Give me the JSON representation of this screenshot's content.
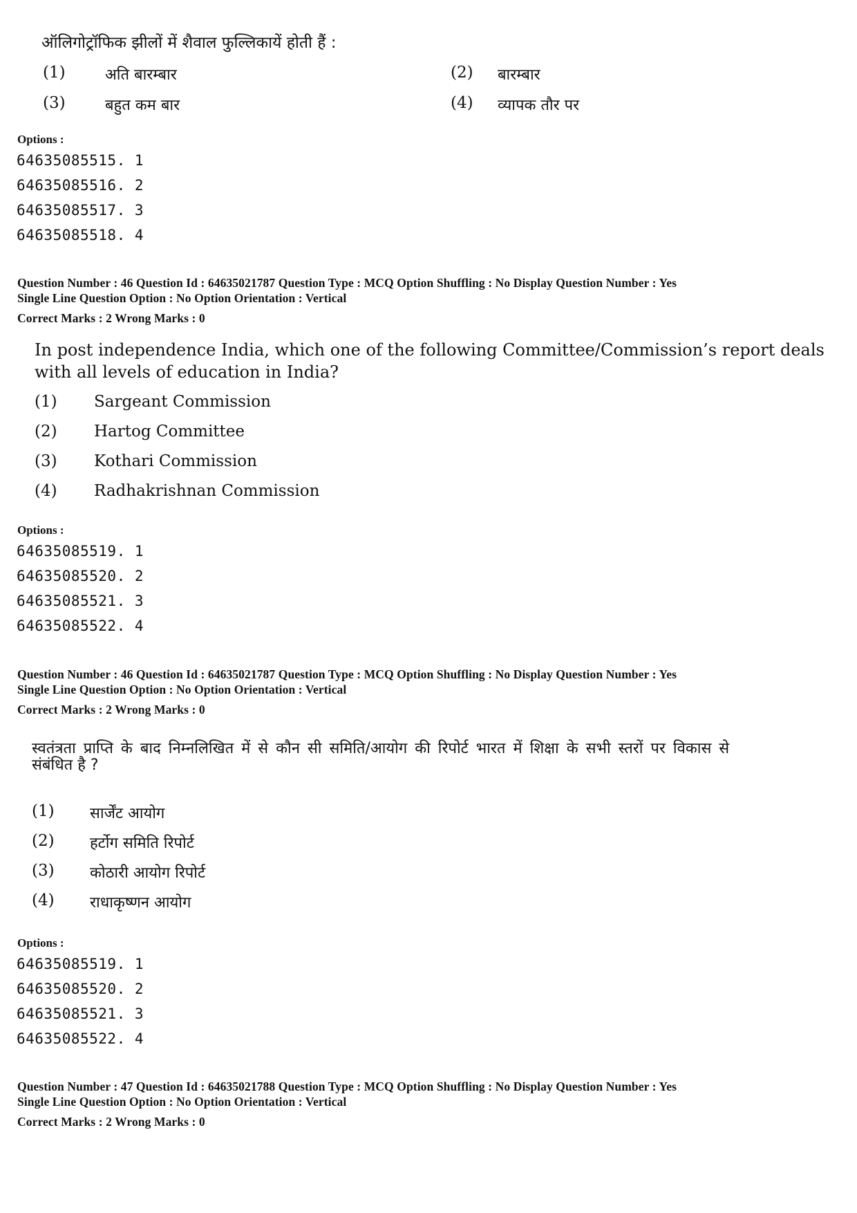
{
  "block1": {
    "question_text": "ऑलिगोट्रॉफिक झीलों में शैवाल फुल्लिकायें होती हैं :",
    "choices": [
      {
        "num": "(1)",
        "text": "अति बारम्बार"
      },
      {
        "num": "(2)",
        "text": "बारम्बार"
      },
      {
        "num": "(3)",
        "text": "बहुत कम बार"
      },
      {
        "num": "(4)",
        "text": "व्यापक तौर पर"
      }
    ],
    "options_label": "Options :",
    "option_ids": [
      "64635085515. 1",
      "64635085516. 2",
      "64635085517. 3",
      "64635085518. 4"
    ]
  },
  "block2": {
    "meta_line1": "Question Number : 46  Question Id : 64635021787  Question Type : MCQ  Option Shuffling : No  Display Question Number : Yes",
    "meta_line2": "Single Line Question Option : No  Option Orientation : Vertical",
    "marks": "Correct Marks : 2  Wrong Marks : 0",
    "question_line1": "In post independence India, which one of the following Committee/Commission’s report deals",
    "question_line2": "with all levels of education in India?",
    "choices": [
      {
        "num": "(1)",
        "text": "Sargeant Commission"
      },
      {
        "num": "(2)",
        "text": "Hartog Committee"
      },
      {
        "num": "(3)",
        "text": "Kothari Commission"
      },
      {
        "num": "(4)",
        "text": "Radhakrishnan Commission"
      }
    ],
    "options_label": "Options :",
    "option_ids": [
      "64635085519. 1",
      "64635085520. 2",
      "64635085521. 3",
      "64635085522. 4"
    ]
  },
  "block3": {
    "meta_line1": "Question Number : 46  Question Id : 64635021787  Question Type : MCQ  Option Shuffling : No  Display Question Number : Yes",
    "meta_line2": "Single Line Question Option : No  Option Orientation : Vertical",
    "marks": "Correct Marks : 2  Wrong Marks : 0",
    "question_line1": "स्वतंत्रता प्राप्ति के बाद निम्नलिखित में से कौन सी समिति/आयोग की रिपोर्ट भारत में शिक्षा के सभी स्तरों पर विकास से",
    "question_line2": "संबंधित है ?",
    "choices": [
      {
        "num": "(1)",
        "text": "सार्जेंट आयोग"
      },
      {
        "num": "(2)",
        "text": "हर्टोग समिति रिपोर्ट"
      },
      {
        "num": "(3)",
        "text": "कोठारी आयोग रिपोर्ट"
      },
      {
        "num": "(4)",
        "text": "राधाकृष्णन आयोग"
      }
    ],
    "options_label": "Options :",
    "option_ids": [
      "64635085519. 1",
      "64635085520. 2",
      "64635085521. 3",
      "64635085522. 4"
    ]
  },
  "block4": {
    "meta_line1": "Question Number : 47  Question Id : 64635021788  Question Type : MCQ  Option Shuffling : No  Display Question Number : Yes",
    "meta_line2": "Single Line Question Option : No  Option Orientation : Vertical",
    "marks": "Correct Marks : 2  Wrong Marks : 0"
  }
}
